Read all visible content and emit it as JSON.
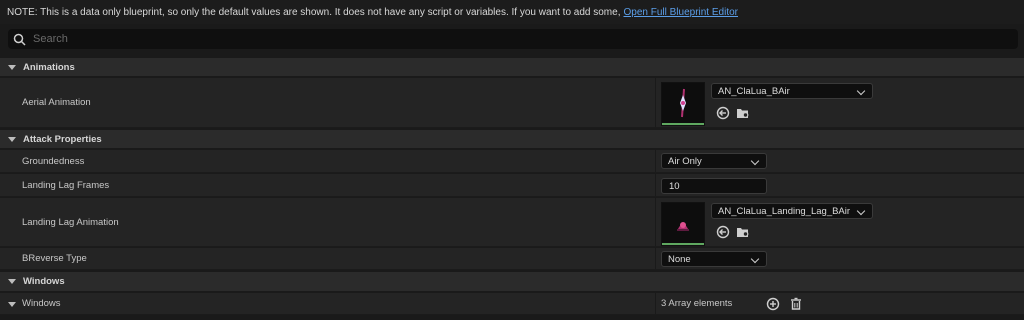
{
  "note": {
    "text": "NOTE: This is a data only blueprint, so only the default values are shown.  It does not have any script or variables.  If you want to add some,",
    "link": "Open Full Blueprint Editor"
  },
  "search": {
    "placeholder": "Search"
  },
  "categories": {
    "animations": "Animations",
    "attack_properties": "Attack Properties",
    "windows": "Windows"
  },
  "properties": {
    "aerial_animation": {
      "label": "Aerial Animation",
      "value": "AN_ClaLua_BAir"
    },
    "groundedness": {
      "label": "Groundedness",
      "value": "Air Only"
    },
    "landing_lag_frames": {
      "label": "Landing Lag Frames",
      "value": "10"
    },
    "landing_lag_animation": {
      "label": "Landing Lag Animation",
      "value": "AN_ClaLua_Landing_Lag_BAir"
    },
    "breverse_type": {
      "label": "BReverse Type",
      "value": "None"
    },
    "windows": {
      "label": "Windows",
      "value": "3 Array elements"
    }
  },
  "icons": {
    "search": "search-icon",
    "use_selected": "use-selected-asset-icon",
    "browse": "browse-asset-icon",
    "add": "add-element-icon",
    "delete": "delete-all-icon"
  },
  "colors": {
    "link": "#5b9ee8",
    "accent": "#3a7bd5",
    "thumb_bar": "#5fa860"
  }
}
